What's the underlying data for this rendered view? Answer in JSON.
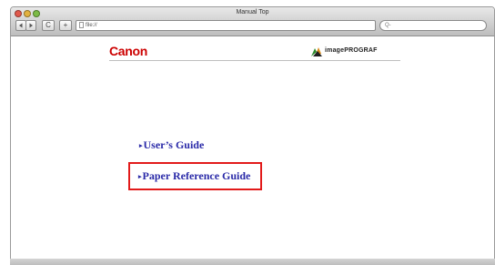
{
  "window": {
    "title": "Manual Top"
  },
  "toolbar": {
    "back_icon": "back-arrow-icon",
    "forward_icon": "forward-arrow-icon",
    "reload_label": "C",
    "add_label": "+"
  },
  "address": {
    "url": "file://",
    "search_placeholder": "Q-"
  },
  "page": {
    "brand_logo_text": "Canon",
    "product_logo_text": "imagePROGRAF",
    "links": [
      {
        "label": "User’s Guide",
        "marker": "▸"
      },
      {
        "label": "Paper Reference Guide",
        "marker": "▸"
      }
    ]
  },
  "colors": {
    "brand_red": "#cc0000",
    "link_blue": "#2a2aa8",
    "highlight": "#e21a1a"
  }
}
